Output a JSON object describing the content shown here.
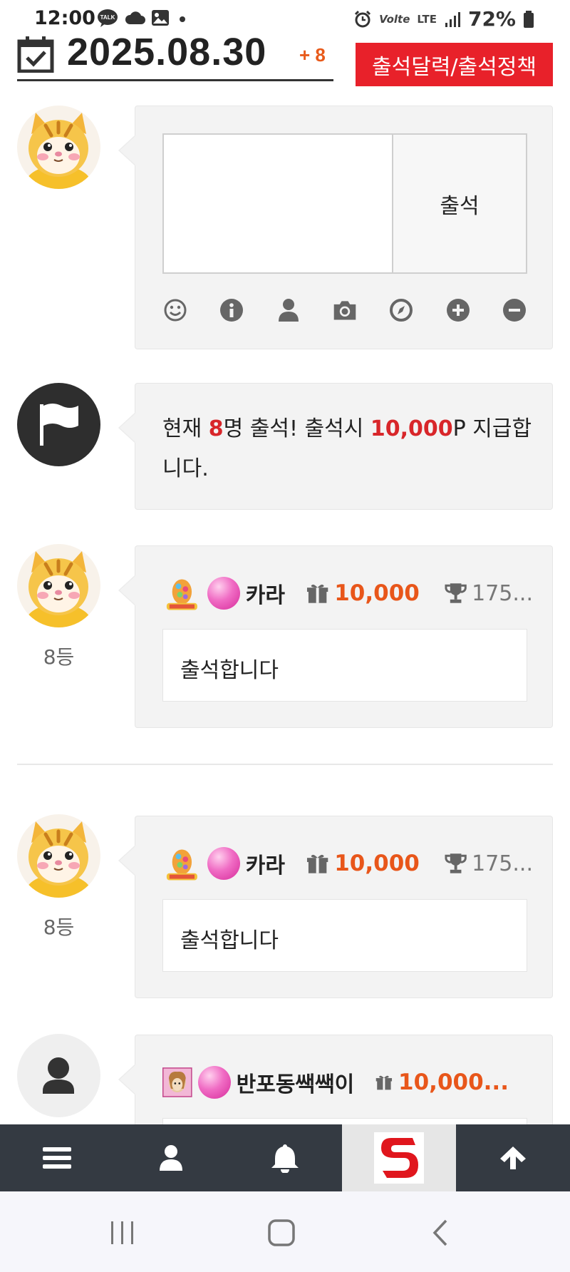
{
  "statusbar": {
    "time": "12:00",
    "talk_label": "TALK",
    "volte_label": "Volte",
    "lte_label": "LTE",
    "battery": "72%"
  },
  "header": {
    "date": "2025.08.30",
    "count": "+ 8",
    "calendar_button": "출석달력/출석정책"
  },
  "compose": {
    "placeholder": "",
    "submit_label": "출석",
    "toolbar_icons": [
      "smile-icon",
      "info-icon",
      "user-icon",
      "camera-icon",
      "compass-icon",
      "plus-icon",
      "minus-icon"
    ]
  },
  "notice": {
    "prefix": "현재 ",
    "count": "8",
    "middle": "명 출석! 출석시 ",
    "points": "10,000",
    "suffix": "P 지급합니다."
  },
  "entries": [
    {
      "rank": "8등",
      "nick": "카라",
      "points": "10,000",
      "score": "175...",
      "message": "출석합니다"
    },
    {
      "rank": "8등",
      "nick": "카라",
      "points": "10,000",
      "score": "175...",
      "message": "출석합니다"
    },
    {
      "rank": "",
      "nick": "반포동쌕쌕이",
      "points": "10,000...",
      "score": "",
      "message": ""
    }
  ],
  "bottom_nav": [
    "menu-icon",
    "user-icon",
    "bell-icon",
    "site-logo",
    "arrow-up-icon"
  ],
  "colors": {
    "accent_red": "#e8212a",
    "points_orange": "#e8561a",
    "nav_bg": "#343a42"
  }
}
